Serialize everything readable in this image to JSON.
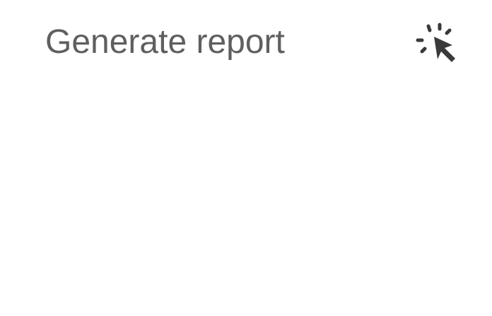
{
  "action": {
    "label": "Generate report",
    "icon": "click-cursor-icon",
    "icon_color": "#3a3a3a",
    "label_color": "#5f5f5f"
  }
}
